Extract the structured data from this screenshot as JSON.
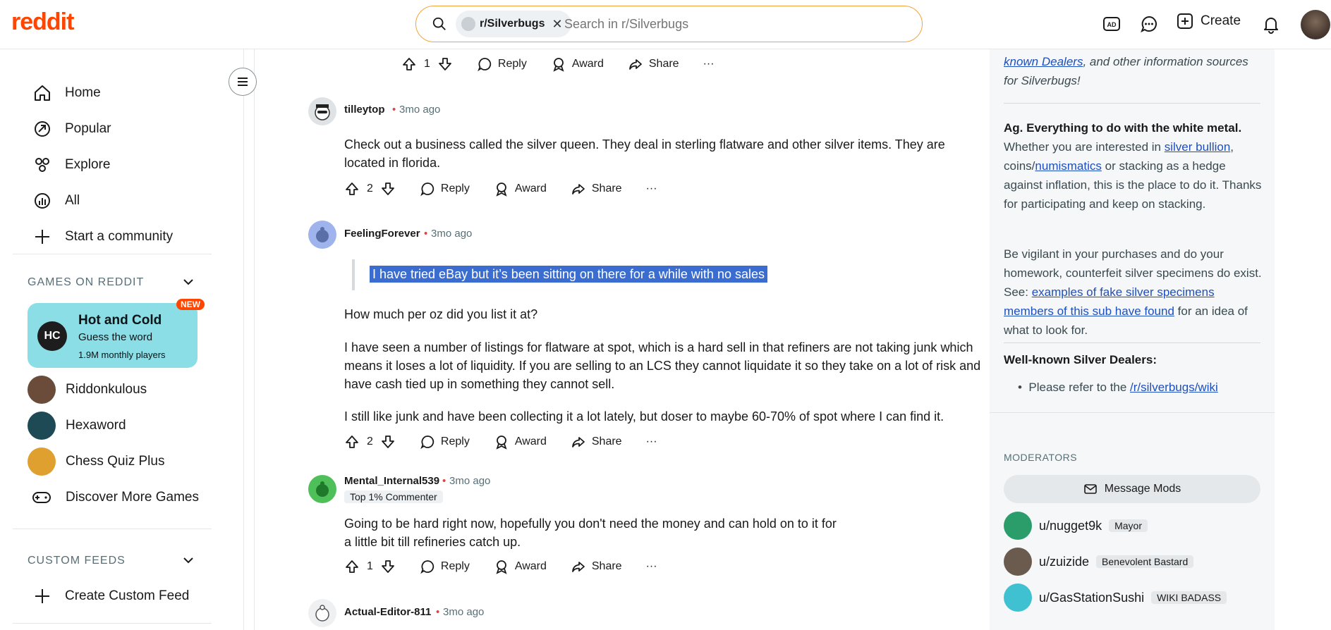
{
  "header": {
    "logo": "reddit",
    "search_chip": "r/Silverbugs",
    "search_placeholder": "Search in r/Silverbugs",
    "create_label": "Create"
  },
  "sidebar": {
    "nav": [
      {
        "label": "Home",
        "icon": "home-icon"
      },
      {
        "label": "Popular",
        "icon": "popular-icon"
      },
      {
        "label": "Explore",
        "icon": "explore-icon"
      },
      {
        "label": "All",
        "icon": "all-icon"
      },
      {
        "label": "Start a community",
        "icon": "plus-icon"
      }
    ],
    "games_header": "GAMES ON REDDIT",
    "featured_game": {
      "title": "Hot and Cold",
      "subtitle": "Guess the word",
      "meta": "1.9M monthly players",
      "badge": "NEW",
      "icon_text": "HC"
    },
    "games": [
      "Riddonkulous",
      "Hexaword",
      "Chess Quiz Plus",
      "Discover More Games"
    ],
    "custom_feeds_header": "CUSTOM FEEDS",
    "create_feed": "Create Custom Feed"
  },
  "comments": [
    {
      "id": "top-partial",
      "votes": "1"
    },
    {
      "id": "tilleytop",
      "user": "tilleytop",
      "time": "3mo ago",
      "text": "Check out a business called the silver queen. They deal in sterling flatware and other silver items. They are located in florida.",
      "votes": "2"
    },
    {
      "id": "feelingforever",
      "user": "FeelingForever",
      "time": "3mo ago",
      "quote": "I have tried eBay but it’s been sitting on there for a while with no sales",
      "p1": "How much per oz did you list it at?",
      "p2": "I have seen a number of listings for flatware at spot, which is a hard sell in that refiners are not taking junk which means it loses a lot of liquidity. If you are selling to an LCS they cannot liquidate it so they take on a lot of risk and have cash tied up in something they cannot sell.",
      "p3": "I still like junk and have been collecting it a lot lately, but doser to maybe 60-70% of spot where I can find it.",
      "votes": "2"
    },
    {
      "id": "mental",
      "user": "Mental_Internal539",
      "time": "3mo ago",
      "flair": "Top 1% Commenter",
      "text": "Going to be hard right now, hopefully you don't need the money and can hold on to it for a little bit till refineries catch up.",
      "votes": "1"
    },
    {
      "id": "actual",
      "user": "Actual-Editor-811",
      "time": "3mo ago"
    }
  ],
  "actions": {
    "reply": "Reply",
    "award": "Award",
    "share": "Share",
    "more": "···"
  },
  "right_sidebar": {
    "intro_link": "known Dealers",
    "intro_rest": ", and other information sources for Silverbugs!",
    "ag_title": "Ag. Everything to do with the white metal.",
    "ag_text_1": " Whether you are interested in ",
    "ag_link_1": "silver bullion",
    "ag_text_2": ", coins/",
    "ag_link_2": "numismatics",
    "ag_text_3": " or stacking as a hedge against inflation, this is the place to do it. Thanks for participating and keep on stacking.",
    "vigilant_1": "Be vigilant in your purchases and do your homework, counterfeit silver specimens do exist. See: ",
    "vigilant_link": "examples of fake silver specimens members of this sub have found",
    "vigilant_2": " for an idea of what to look for.",
    "dealers_title": "Well-known Silver Dealers:",
    "dealers_bullet_text": "Please refer to the ",
    "dealers_bullet_link": "/r/silverbugs/wiki",
    "moderators_header": "MODERATORS",
    "message_mods": "Message Mods",
    "mods": [
      {
        "name": "u/nugget9k",
        "flair": "Mayor",
        "color": "#2a9d6b"
      },
      {
        "name": "u/zuizide",
        "flair": "Benevolent Bastard",
        "color": "#6b5a4e"
      },
      {
        "name": "u/GasStationSushi",
        "flair": "WIKI BADASS",
        "color": "#3fc1d1"
      }
    ]
  }
}
